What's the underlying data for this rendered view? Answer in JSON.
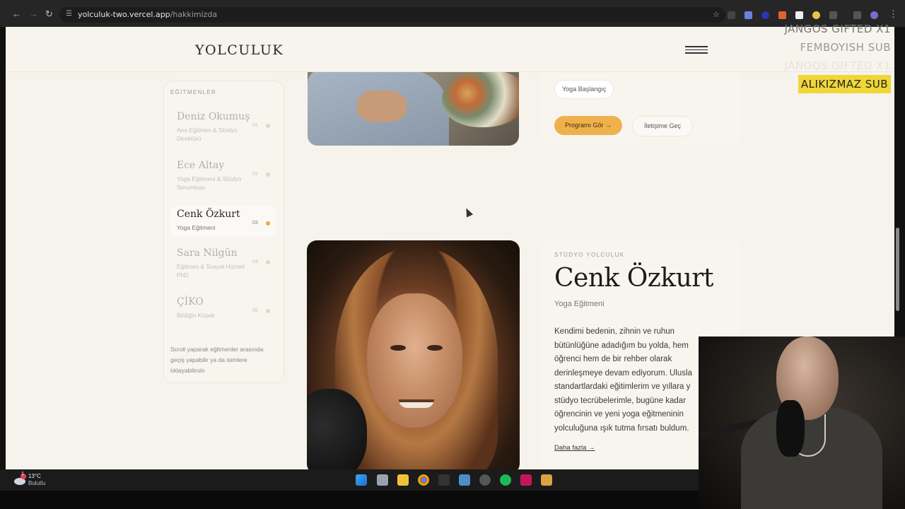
{
  "browser": {
    "url_host": "yolculuk-two.vercel.app",
    "url_path": "/hakkimizda"
  },
  "site": {
    "logo_text": "YOLCULUK"
  },
  "previous_card": {
    "tag": "Yoga Başlangıç",
    "primary_button": "Programı Gör",
    "secondary_button": "İletişime Geç"
  },
  "sidebar": {
    "title": "EĞİTMENLER",
    "items": [
      {
        "name": "Deniz Okumuş",
        "role": "Ana Eğitmen & Stüdyo Direktörü",
        "num": "01"
      },
      {
        "name": "Ece Altay",
        "role": "Yoga Eğitmeni & Stüdyo Sorumlusu",
        "num": "02"
      },
      {
        "name": "Cenk Özkurt",
        "role": "Yoga Eğitmeni",
        "num": "03"
      },
      {
        "name": "Sara Nilgün",
        "role": "Eğitmen & Sosyal Hizmet PhD",
        "num": "04"
      },
      {
        "name": "ÇİKO",
        "role": "Bildiğin Köpek",
        "num": "05"
      }
    ],
    "active_index": 2,
    "hint": "Scroll yaparak eğitmenler arasında geçiş yapabilir ya da isimlere tıklayabilirsin"
  },
  "instructor": {
    "label": "STÜDYO YOLCULUK",
    "name": "Cenk Özkurt",
    "role": "Yoga Eğitmeni",
    "bio_lines": [
      "Kendimi bedenin, zihnin ve ruhun",
      "bütünlüğüne adadığım bu yolda, hem",
      "öğrenci hem de bir rehber olarak",
      "derinleşmeye devam ediyorum. Ulusla",
      "standartlardaki eğitimlerim ve yıllara y",
      "stüdyo tecrübelerimle, bugüne kadar",
      "öğrencinin ve yeni yoga eğitmeninin",
      "yolculuğuna ışık tutma fırsatı buldum."
    ],
    "more_link": "Daha fazla"
  },
  "stream_overlay": {
    "lines": [
      "JANGOS  GIFTED X1",
      "FEMBOYISH  SUB",
      "JANGOS  GIFTED X1",
      "ALIKIZMAZ  SUB"
    ]
  },
  "taskbar": {
    "temperature": "13°C",
    "condition": "Bulutlu",
    "notification_count": "1"
  }
}
